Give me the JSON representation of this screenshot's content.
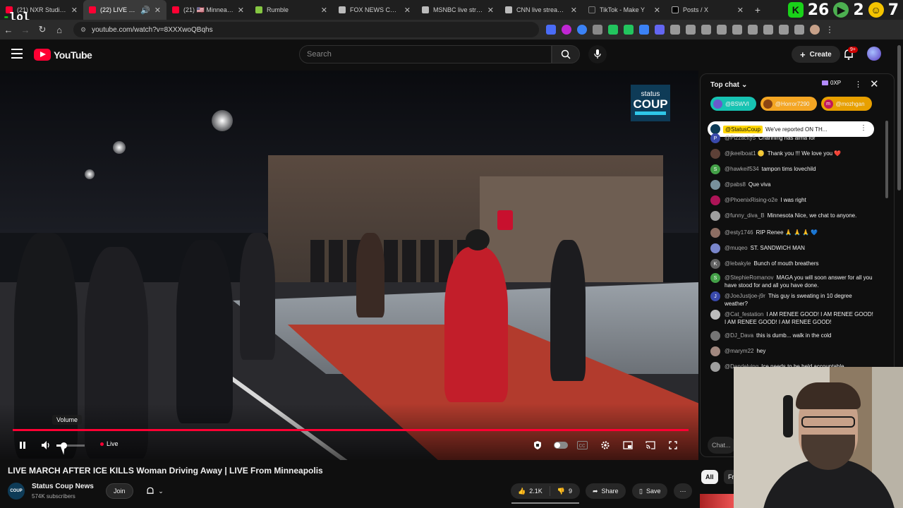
{
  "browser": {
    "tabs": [
      {
        "label": "(21) NXR Studios -",
        "color": "#ff0033"
      },
      {
        "label": "(22) LIVE MARCH",
        "color": "#ff0033",
        "active": true
      },
      {
        "label": "(21) 🇺🇸 Minneapolis",
        "color": "#ff0033"
      },
      {
        "label": "Rumble",
        "color": "#85c742"
      },
      {
        "label": "FOX NEWS CHANN",
        "color": "#bbbbbb"
      },
      {
        "label": "MSNBC live stream",
        "color": "#bbbbbb"
      },
      {
        "label": "CNN live stream -",
        "color": "#bbbbbb"
      },
      {
        "label": "TikTok - Make Y",
        "color": "#bbbbbb"
      },
      {
        "label": "Posts / X",
        "color": "#dddddd"
      }
    ],
    "overlay_text": "lol",
    "counter_a": "26",
    "counter_b": "2",
    "counter_c": "7",
    "url": "youtube.com/watch?v=8XXXwoQBqhs"
  },
  "youtube": {
    "logo_text": "YouTube",
    "search_placeholder": "Search",
    "create_label": "Create",
    "notif_count": "9+"
  },
  "video": {
    "watermark_top": "status",
    "watermark_bottom": "COUP",
    "volume_tooltip": "Volume",
    "volume_level": 0.25,
    "live_label": "Live",
    "title": "LIVE MARCH AFTER ICE KILLS Woman Driving Away | LIVE From Minneapolis"
  },
  "channel": {
    "name": "Status Coup News",
    "subscribers": "574K subscribers",
    "avatar_text": "COUP",
    "join_label": "Join",
    "likes": "2.1K",
    "dislikes": "9",
    "share_label": "Share",
    "save_label": "Save"
  },
  "chat": {
    "header": "Top chat",
    "xp": "0XP",
    "donors": [
      {
        "name": "@BSWVI",
        "bg": "#17c3b2",
        "av": "#6a5acd"
      },
      {
        "name": "@Horror7290",
        "bg": "#f4a623",
        "av": "#8b4513"
      },
      {
        "name": "@mozhgan",
        "bg": "#e8a000",
        "av": "#c2185b",
        "letter": "m"
      }
    ],
    "pinned_author": "@StatusCoup",
    "pinned_text": "We've reported ON TH...",
    "messages": [
      {
        "author": "@Pizzacity5",
        "text": "Channing has alma for",
        "av": "#3949ab",
        "letter": "P"
      },
      {
        "author": "@jkeelboat1 🪙",
        "text": "Thank you !!! We love you ❤️",
        "av": "#5d4037"
      },
      {
        "author": "@hawkeif534",
        "text": "tampon tims lovechild",
        "av": "#43a047",
        "letter": "S"
      },
      {
        "author": "@pabs8",
        "text": "Que viva",
        "av": "#78909c"
      },
      {
        "author": "@PhoenixRising-o2e",
        "text": "I was right",
        "av": "#ad1457"
      },
      {
        "author": "@funny_diva_B",
        "text": "Minnesota Nice, we chat to anyone.",
        "av": "#9e9e9e"
      },
      {
        "author": "@esty1746",
        "text": "RIP Renee 🙏 🙏 🙏 💙",
        "av": "#8d6e63"
      },
      {
        "author": "@muqeo",
        "text": "ST. SANDWICH MAN",
        "av": "#7986cb"
      },
      {
        "author": "@lebakyle",
        "text": "Bunch of mouth breathers",
        "av": "#616161",
        "letter": "K"
      },
      {
        "author": "@StephieRomanov",
        "text": "MAGA you will soon answer for all you have stood for and all you have done.",
        "av": "#43a047",
        "letter": "S"
      },
      {
        "author": "@JoeJustjoe-j9r",
        "text": "This guy is sweating in 10 degree weather?",
        "av": "#3949ab",
        "letter": "J"
      },
      {
        "author": "@Cat_festation",
        "text": "I AM RENEE GOOD! I AM RENEE GOOD! I AM RENEE GOOD! I AM RENEE GOOD!",
        "av": "#bdbdbd"
      },
      {
        "author": "@DJ_Dava",
        "text": "this is dumb... walk in the cold",
        "av": "#757575"
      },
      {
        "author": "@marym22",
        "text": "hey",
        "av": "#a1887f"
      },
      {
        "author": "@Dandelying",
        "text": "Ice needs to be held accountable.",
        "av": "#9e9e9e"
      }
    ],
    "input_placeholder": "Chat..."
  },
  "related": {
    "chip_all": "All",
    "chip_fr": "Fr"
  }
}
